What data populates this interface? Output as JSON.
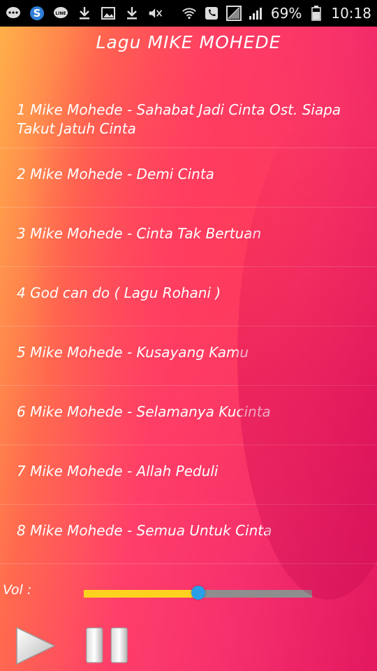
{
  "statusbar": {
    "battery_percent": "69%",
    "time": "10:18",
    "left_icons": [
      "chat-bubble-icon",
      "s-app-icon",
      "line-app-icon",
      "download-icon",
      "image-icon",
      "download-icon",
      "mute-icon"
    ],
    "right_icons": [
      "wifi-icon",
      "phone-icon",
      "nosignal-icon",
      "signal-icon",
      "battery-icon"
    ]
  },
  "app": {
    "title": "Lagu MIKE MOHEDE",
    "songs": [
      "1 Mike Mohede - Sahabat Jadi Cinta Ost. Siapa Takut Jatuh Cinta",
      "2 Mike Mohede - Demi Cinta",
      "3 Mike Mohede - Cinta Tak Bertuan",
      "4 God can do ( Lagu Rohani )",
      "5 Mike Mohede - Kusayang Kamu",
      "6 Mike Mohede - Selamanya Kucinta",
      "7 Mike Mohede - Allah Peduli",
      "8 Mike Mohede - Semua Untuk Cinta"
    ],
    "volume_label": "Vol :",
    "volume_level": 0.5,
    "colors": {
      "slider_fill": "#ffd21f",
      "slider_track": "#8e8e8e",
      "slider_thumb": "#2a9ee6"
    }
  }
}
